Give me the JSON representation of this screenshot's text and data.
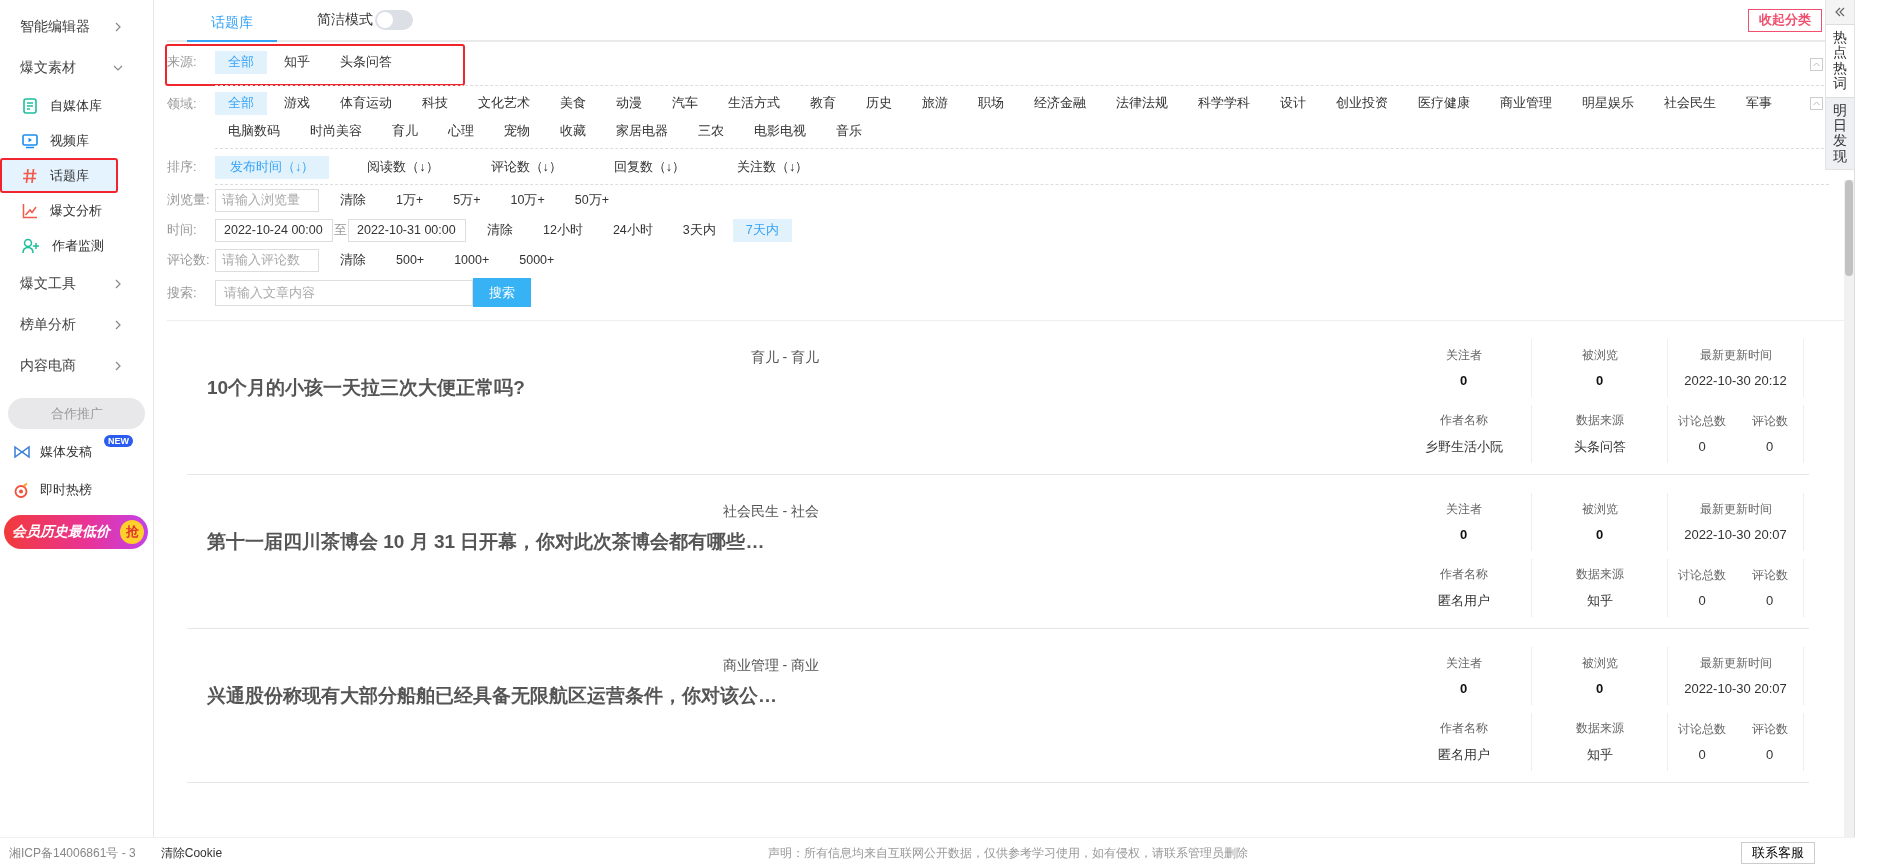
{
  "sidebar": {
    "items": [
      {
        "label": "智能编辑器",
        "expanded": false
      },
      {
        "label": "爆文素材",
        "expanded": true,
        "children": [
          {
            "label": "自媒体库",
            "selected": false,
            "highlighted": false
          },
          {
            "label": "视频库",
            "selected": false,
            "highlighted": false
          },
          {
            "label": "话题库",
            "selected": true,
            "highlighted": true
          },
          {
            "label": "爆文分析",
            "selected": false,
            "highlighted": false
          },
          {
            "label": "作者监测",
            "selected": false,
            "highlighted": false
          }
        ]
      },
      {
        "label": "爆文工具",
        "expanded": false
      },
      {
        "label": "榜单分析",
        "expanded": false
      },
      {
        "label": "内容电商",
        "expanded": false
      }
    ],
    "promo_header": "合作推广",
    "promo_items": [
      {
        "label": "媒体发稿",
        "badge": "NEW"
      },
      {
        "label": "即时热榜"
      }
    ],
    "banner": {
      "text": "会员历史最低价",
      "badge": "抢"
    }
  },
  "tabs": [
    {
      "label": "话题库",
      "selected": true
    }
  ],
  "compact_mode": {
    "label": "简洁模式",
    "on": false
  },
  "collapse_button": "收起分类",
  "filters": {
    "source": {
      "label": "来源:",
      "highlighted": true,
      "options": [
        {
          "label": "全部",
          "selected": true
        },
        {
          "label": "知乎",
          "selected": false
        },
        {
          "label": "头条问答",
          "selected": false
        }
      ]
    },
    "domain": {
      "label": "领域:",
      "options": [
        {
          "label": "全部",
          "selected": true
        },
        {
          "label": "游戏",
          "selected": false
        },
        {
          "label": "体育运动",
          "selected": false
        },
        {
          "label": "科技",
          "selected": false
        },
        {
          "label": "文化艺术",
          "selected": false
        },
        {
          "label": "美食",
          "selected": false
        },
        {
          "label": "动漫",
          "selected": false
        },
        {
          "label": "汽车",
          "selected": false
        },
        {
          "label": "生活方式",
          "selected": false
        },
        {
          "label": "教育",
          "selected": false
        },
        {
          "label": "历史",
          "selected": false
        },
        {
          "label": "旅游",
          "selected": false
        },
        {
          "label": "职场",
          "selected": false
        },
        {
          "label": "经济金融",
          "selected": false
        },
        {
          "label": "法律法规",
          "selected": false
        },
        {
          "label": "科学学科",
          "selected": false
        },
        {
          "label": "设计",
          "selected": false
        },
        {
          "label": "创业投资",
          "selected": false
        },
        {
          "label": "医疗健康",
          "selected": false
        },
        {
          "label": "商业管理",
          "selected": false
        },
        {
          "label": "明星娱乐",
          "selected": false
        },
        {
          "label": "社会民生",
          "selected": false
        },
        {
          "label": "军事",
          "selected": false
        },
        {
          "label": "电脑数码",
          "selected": false
        },
        {
          "label": "时尚美容",
          "selected": false
        },
        {
          "label": "育儿",
          "selected": false
        },
        {
          "label": "心理",
          "selected": false
        },
        {
          "label": "宠物",
          "selected": false
        },
        {
          "label": "收藏",
          "selected": false
        },
        {
          "label": "家居电器",
          "selected": false
        },
        {
          "label": "三农",
          "selected": false
        },
        {
          "label": "电影电视",
          "selected": false
        },
        {
          "label": "音乐",
          "selected": false
        }
      ]
    },
    "sort": {
      "label": "排序:",
      "options": [
        {
          "label": "发布时间（↓）",
          "selected": true
        },
        {
          "label": "阅读数（↓）",
          "selected": false
        },
        {
          "label": "评论数（↓）",
          "selected": false
        },
        {
          "label": "回复数（↓）",
          "selected": false
        },
        {
          "label": "关注数（↓）",
          "selected": false
        }
      ]
    },
    "views": {
      "label": "浏览量:",
      "placeholder": "请输入浏览量",
      "clear": "清除",
      "options": [
        {
          "label": "1万+",
          "selected": false
        },
        {
          "label": "5万+",
          "selected": false
        },
        {
          "label": "10万+",
          "selected": false
        },
        {
          "label": "50万+",
          "selected": false
        }
      ]
    },
    "time": {
      "label": "时间:",
      "start": "2022-10-24 00:00",
      "separator": "至",
      "end": "2022-10-31 00:00",
      "clear": "清除",
      "options": [
        {
          "label": "12小时",
          "selected": false
        },
        {
          "label": "24小时",
          "selected": false
        },
        {
          "label": "3天内",
          "selected": false
        },
        {
          "label": "7天内",
          "selected": true
        }
      ]
    },
    "comments": {
      "label": "评论数:",
      "placeholder": "请输入评论数",
      "clear": "清除",
      "options": [
        {
          "label": "500+",
          "selected": false
        },
        {
          "label": "1000+",
          "selected": false
        },
        {
          "label": "5000+",
          "selected": false
        }
      ]
    },
    "search": {
      "label": "搜索:",
      "placeholder": "请输入文章内容",
      "button": "搜索"
    }
  },
  "topics": [
    {
      "category": "育儿 - 育儿",
      "title": "10个月的小孩一天拉三次大便正常吗?",
      "top": [
        {
          "label": "关注者",
          "value": "0"
        },
        {
          "label": "被浏览",
          "value": "0"
        },
        {
          "label": "最新更新时间",
          "value": "2022-10-30 20:12"
        }
      ],
      "bottom": [
        {
          "label": "作者名称",
          "value": "乡野生活小阮"
        },
        {
          "label": "数据来源",
          "value": "头条问答"
        },
        {
          "label": "讨论总数",
          "value": "0"
        },
        {
          "label": "评论数",
          "value": "0"
        }
      ]
    },
    {
      "category": "社会民生 - 社会",
      "title": "第十一届四川茶博会 10 月 31 日开幕，你对此次茶博会都有哪些…",
      "top": [
        {
          "label": "关注者",
          "value": "0"
        },
        {
          "label": "被浏览",
          "value": "0"
        },
        {
          "label": "最新更新时间",
          "value": "2022-10-30 20:07"
        }
      ],
      "bottom": [
        {
          "label": "作者名称",
          "value": "匿名用户"
        },
        {
          "label": "数据来源",
          "value": "知乎"
        },
        {
          "label": "讨论总数",
          "value": "0"
        },
        {
          "label": "评论数",
          "value": "0"
        }
      ]
    },
    {
      "category": "商业管理 - 商业",
      "title": "兴通股份称现有大部分船舶已经具备无限航区运营条件，你对该公…",
      "top": [
        {
          "label": "关注者",
          "value": "0"
        },
        {
          "label": "被浏览",
          "value": "0"
        },
        {
          "label": "最新更新时间",
          "value": "2022-10-30 20:07"
        }
      ],
      "bottom": [
        {
          "label": "作者名称",
          "value": "匿名用户"
        },
        {
          "label": "数据来源",
          "value": "知乎"
        },
        {
          "label": "讨论总数",
          "value": "0"
        },
        {
          "label": "评论数",
          "value": "0"
        }
      ]
    }
  ],
  "side_tabs": [
    {
      "label": "热点热词",
      "selected": false
    },
    {
      "label": "明日发现",
      "selected": true
    }
  ],
  "footer": {
    "icp": "湘ICP备14006861号 - 3",
    "clear_cookie": "清除Cookie",
    "notice": "声明：所有信息均来自互联网公开数据，仅供参考学习使用，如有侵权，请联系管理员删除",
    "contact": "联系客服"
  }
}
